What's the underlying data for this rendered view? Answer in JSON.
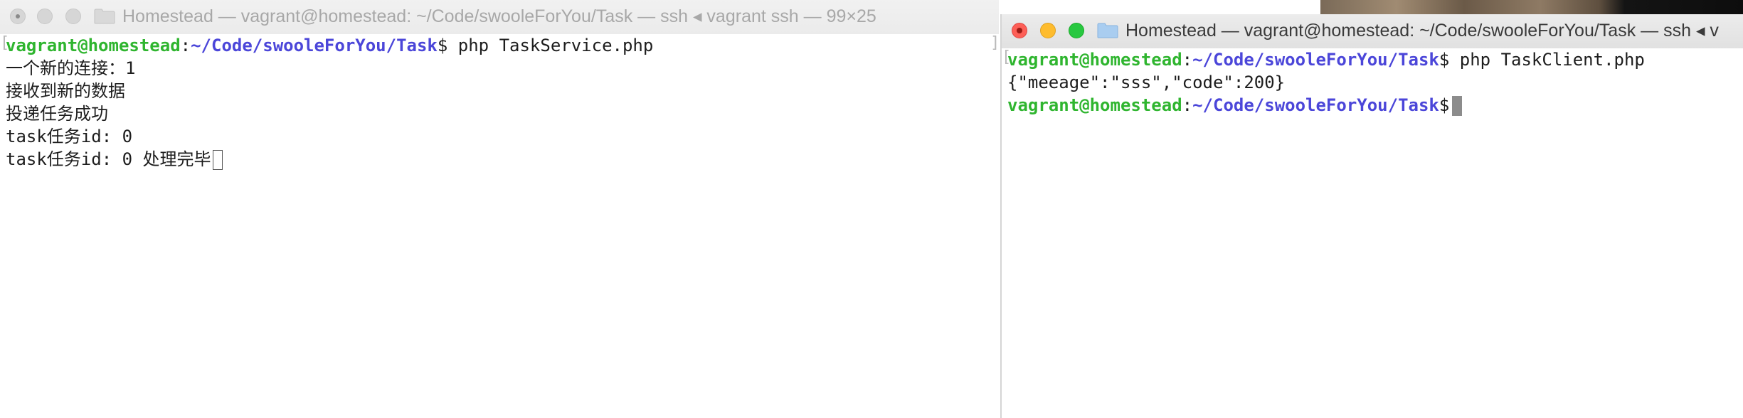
{
  "left_window": {
    "title": "Homestead — vagrant@homestead: ~/Code/swooleForYou/Task — ssh ◂ vagrant ssh — 99×25",
    "prompt": {
      "user": "vagrant@homestead",
      "sep": ":",
      "path": "~/Code/swooleForYou/Task",
      "symbol": "$",
      "command": " php TaskService.php"
    },
    "output": [
      "一个新的连接：1",
      "接收到新的数据",
      "投递任务成功",
      "task任务id: 0",
      "task任务id: 0 处理完毕"
    ]
  },
  "right_window": {
    "title": "Homestead — vagrant@homestead: ~/Code/swooleForYou/Task — ssh ◂ v",
    "prompt": {
      "user": "vagrant@homestead",
      "sep": ":",
      "path": "~/Code/swooleForYou/Task",
      "symbol": "$",
      "command": " php TaskClient.php"
    },
    "output": [
      "{\"meeage\":\"sss\",\"code\":200}"
    ],
    "prompt2": {
      "user": "vagrant@homestead",
      "sep": ":",
      "path": "~/Code/swooleForYou/Task",
      "symbol": "$"
    }
  },
  "icons": {
    "folder": "folder-icon",
    "close": "close-icon",
    "minimize": "minimize-icon",
    "zoom": "zoom-icon"
  },
  "colors": {
    "prompt_user": "#2fb52f",
    "prompt_path": "#4b46d9",
    "close": "#fd5f57",
    "minimize": "#febc2e",
    "zoom": "#28c840"
  }
}
